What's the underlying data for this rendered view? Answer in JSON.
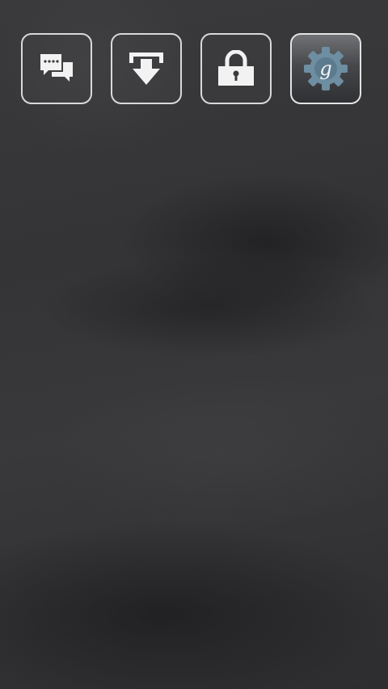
{
  "home": {
    "shortcuts": [
      {
        "id": "messaging",
        "icon": "chat-bubbles-icon"
      },
      {
        "id": "download",
        "icon": "download-arrow-icon"
      },
      {
        "id": "lock",
        "icon": "padlock-icon"
      },
      {
        "id": "google-settings",
        "icon": "gear-g-icon",
        "icon_letter": "g"
      }
    ]
  },
  "colors": {
    "tile_border": "#d9d9d9",
    "icon_fill": "#f2f2f2",
    "gear_fill": "#6e8ea2",
    "background": "#363638"
  }
}
